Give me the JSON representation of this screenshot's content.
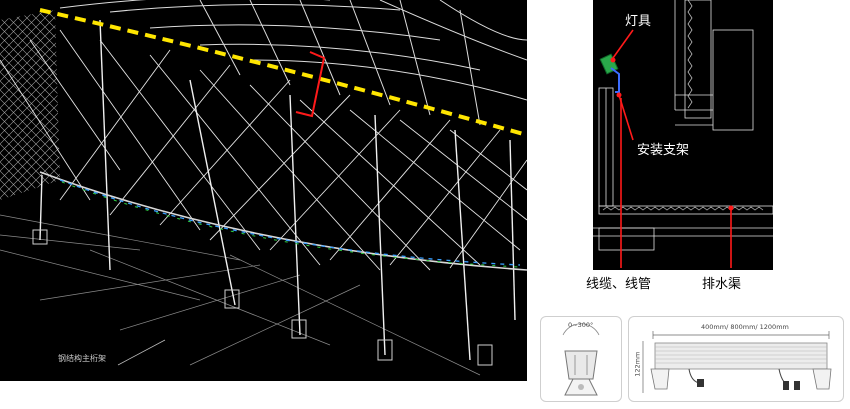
{
  "labels": {
    "main_truss": "钢结构主桁架",
    "fixture": "灯具",
    "bracket": "安装支架",
    "cable": "线缆、线管",
    "drain": "排水渠"
  },
  "dimensions": {
    "angle": "0~300°",
    "lengths": "400mm/ 800mm/ 1200mm",
    "height": "122mm"
  },
  "colors": {
    "light_line": "#ffe600",
    "callout": "#ff1a1a",
    "cad_background": "#000000",
    "cad_line": "#e8e8e8"
  }
}
